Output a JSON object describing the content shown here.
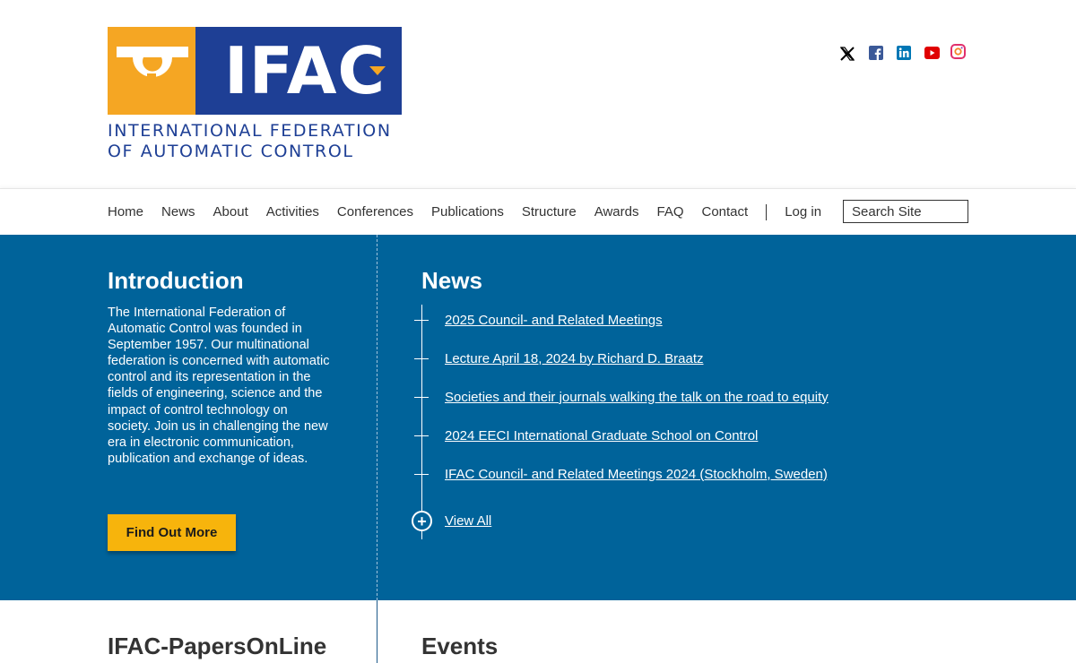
{
  "logo": {
    "word": "IFAC",
    "line1": "INTERNATIONAL FEDERATION",
    "line2": "OF AUTOMATIC CONTROL"
  },
  "social": [
    {
      "icon": "x-twitter-icon",
      "color": "#000000"
    },
    {
      "icon": "facebook-icon",
      "color": "#3b5998"
    },
    {
      "icon": "linkedin-icon",
      "color": "#0077b5"
    },
    {
      "icon": "youtube-icon",
      "color": "#e00000"
    },
    {
      "icon": "instagram-icon",
      "color": "#e1306c"
    }
  ],
  "nav": {
    "items": [
      "Home",
      "News",
      "About",
      "Activities",
      "Conferences",
      "Publications",
      "Structure",
      "Awards",
      "FAQ",
      "Contact"
    ],
    "login": "Log in",
    "search_placeholder": "Search Site"
  },
  "intro": {
    "title": "Introduction",
    "text": "The International Federation of Automatic Control was founded in September 1957. Our multinational federation is concerned with automatic control and its representation in the fields of engineering, science and the impact of control technology on society. Join us in challenging the new era in electronic communication, publication and exchange of ideas.",
    "button": "Find Out More"
  },
  "news": {
    "title": "News",
    "items": [
      "2025 Council- and Related Meetings",
      "Lecture April 18, 2024 by Richard D. Braatz",
      "Societies and their journals walking the talk on the road to equity",
      "2024 EECI International Graduate School on Control",
      "IFAC Council- and Related Meetings 2024 (Stockholm, Sweden)"
    ],
    "view_all": "View All"
  },
  "bottom": {
    "papers_title": "IFAC-PapersOnLine",
    "events_title": "Events"
  },
  "colors": {
    "band": "#00639a",
    "logo_blue": "#1e3f95",
    "logo_orange": "#f5a623",
    "button": "#f7b40c"
  }
}
